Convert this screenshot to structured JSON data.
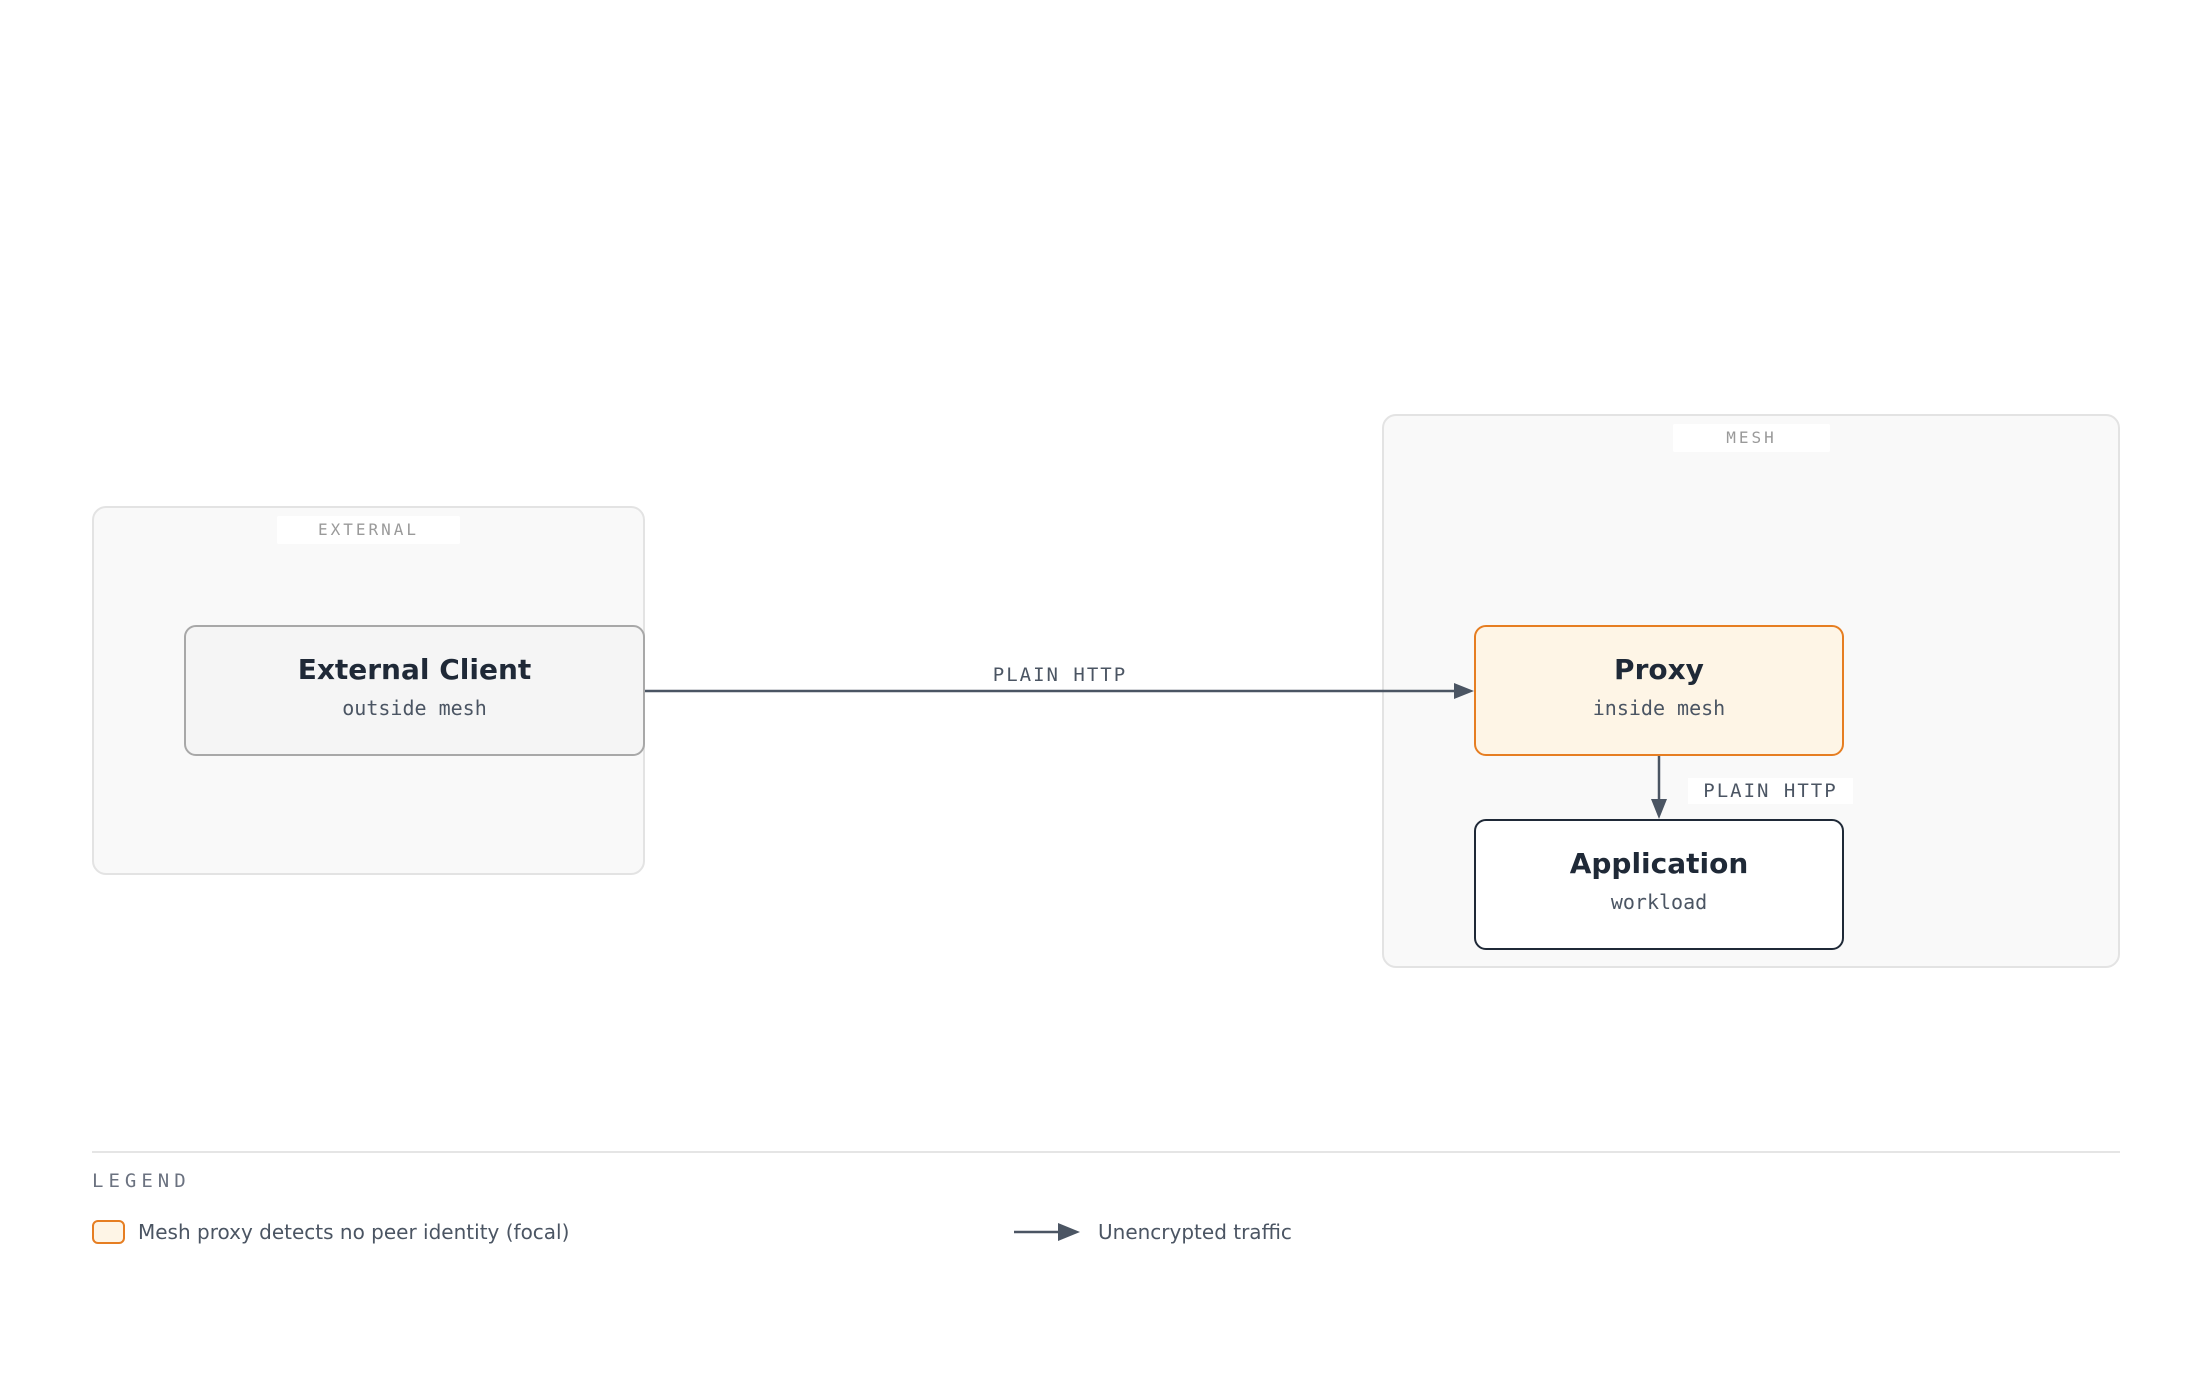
{
  "groups": {
    "external": {
      "label": "EXTERNAL"
    },
    "mesh": {
      "label": "MESH"
    }
  },
  "nodes": {
    "external_client": {
      "title": "External Client",
      "subtitle": "outside mesh"
    },
    "proxy": {
      "title": "Proxy",
      "subtitle": "inside mesh"
    },
    "application": {
      "title": "Application",
      "subtitle": "workload"
    }
  },
  "edges": {
    "client_to_proxy": {
      "label": "PLAIN HTTP"
    },
    "proxy_to_app": {
      "label": "PLAIN HTTP"
    }
  },
  "legend": {
    "title": "LEGEND",
    "items": [
      {
        "label": "Mesh proxy detects no peer identity (focal)"
      },
      {
        "label": "Unencrypted traffic"
      }
    ]
  },
  "colors": {
    "focal_border": "#e67e22",
    "focal_fill": "#fef5e6",
    "edge": "#4b5563",
    "text_dark": "#1f2937"
  }
}
